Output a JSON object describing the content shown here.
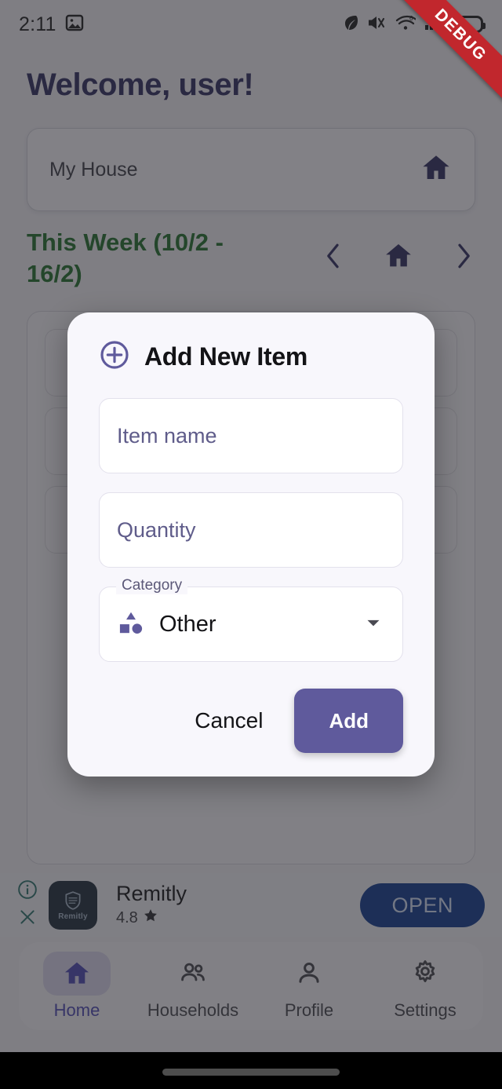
{
  "status_bar": {
    "time": "2:11",
    "left_icons": [
      "image-icon"
    ],
    "right_icons": [
      "leaf-icon",
      "mute-vibrate-icon",
      "wifi-icon",
      "cellular-signal-icon",
      "battery-icon"
    ]
  },
  "debug_banner": {
    "label": "DEBUG",
    "color": "#c1272d"
  },
  "header": {
    "welcome": "Welcome, user!"
  },
  "house_selector": {
    "name": "My House",
    "icon": "home-icon"
  },
  "week_nav": {
    "title": "This Week (10/2 - 16/2)",
    "prev_icon": "chevron-left-icon",
    "home_icon": "home-icon",
    "next_icon": "chevron-right-icon"
  },
  "dialog": {
    "icon": "plus-circle-icon",
    "title": "Add New Item",
    "item_name": {
      "label": "Item name",
      "value": "",
      "placeholder": "Item name"
    },
    "quantity": {
      "label": "Quantity",
      "value": "",
      "placeholder": "Quantity"
    },
    "category": {
      "label": "Category",
      "value": "Other",
      "icon": "shapes-icon",
      "dropdown_icon": "chevron-down-icon"
    },
    "cancel_label": "Cancel",
    "add_label": "Add",
    "accent_color": "#5f5a9c",
    "background": "#f8f7fc"
  },
  "ad": {
    "info_icon": "info-icon",
    "close_icon": "close-icon",
    "app_icon_label": "Remitly",
    "title": "Remitly",
    "rating": "4.8",
    "star_icon": "star-icon",
    "cta_label": "OPEN",
    "cta_color": "#11398c"
  },
  "bottom_nav": {
    "active": "Home",
    "items": [
      {
        "label": "Home",
        "icon": "home-icon"
      },
      {
        "label": "Households",
        "icon": "people-icon"
      },
      {
        "label": "Profile",
        "icon": "person-icon"
      },
      {
        "label": "Settings",
        "icon": "gear-icon"
      }
    ]
  }
}
